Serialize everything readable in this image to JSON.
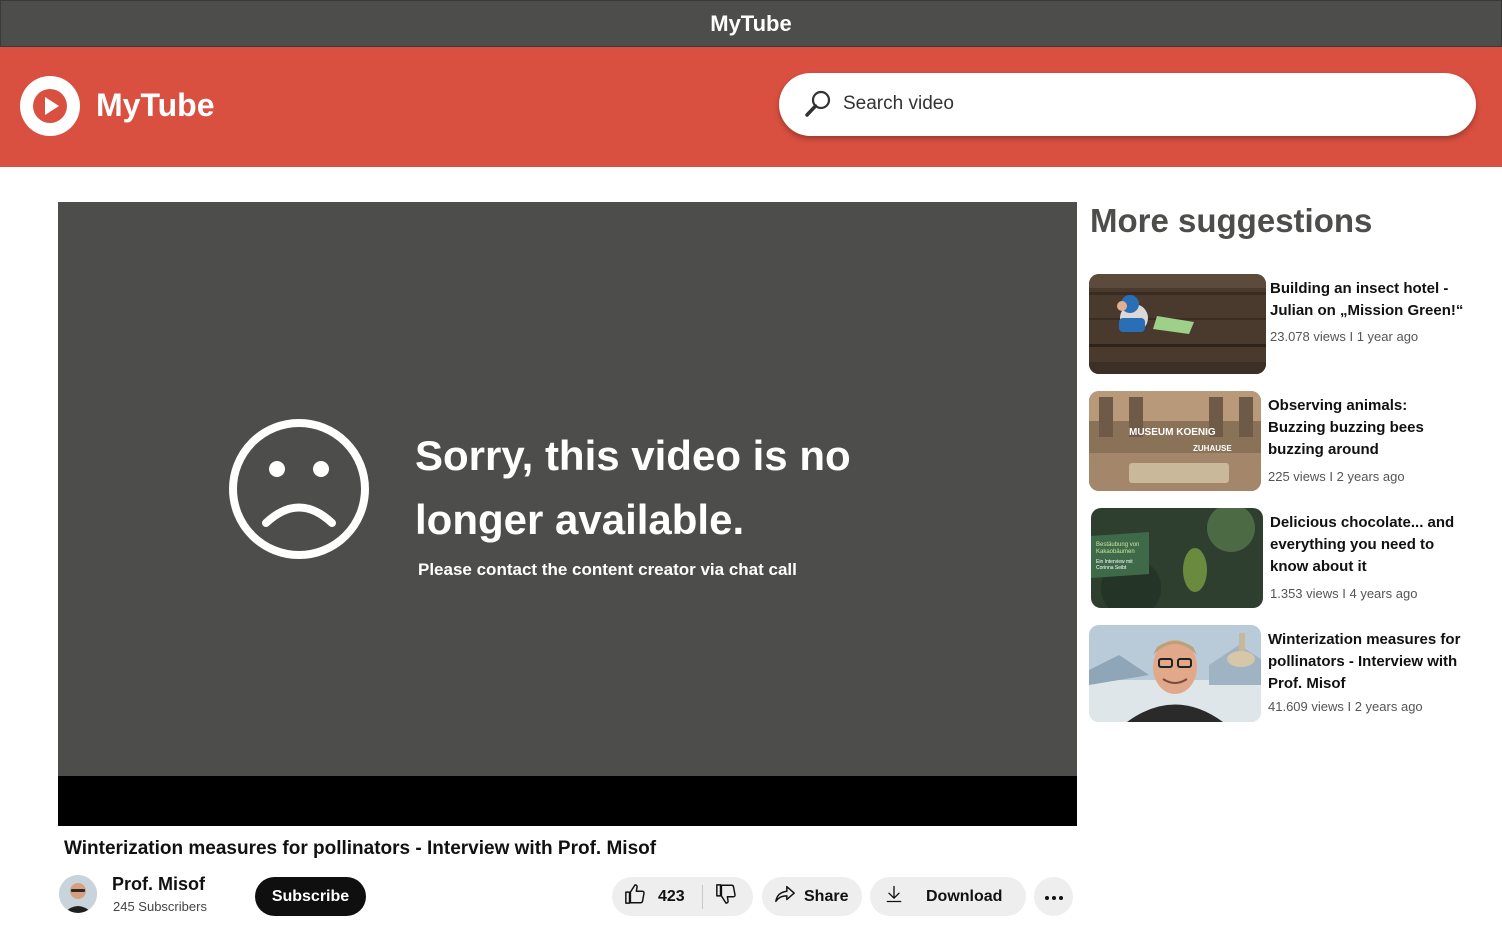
{
  "window": {
    "title": "MyTube"
  },
  "header": {
    "brand": "MyTube",
    "search_placeholder": "Search video",
    "logo_icon": "play-circle-icon",
    "search_icon": "magnifier-icon",
    "accent_color": "#d95040"
  },
  "player": {
    "error_title": "Sorry, this video is no longer available.",
    "error_subtitle": "Please contact the content creator via chat call",
    "icon": "sad-face-icon"
  },
  "video": {
    "title": "Winterization measures for pollinators - Interview with Prof. Misof",
    "channel_name": "Prof. Misof",
    "subscribers": "245 Subscribers",
    "subscribe_label": "Subscribe",
    "likes": "423",
    "share_label": "Share",
    "download_label": "Download"
  },
  "suggestions": {
    "heading": "More suggestions",
    "items": [
      {
        "title": "Building an insect hotel - Julian on „Mission Green!“",
        "meta": "23.078 views I 1 year ago"
      },
      {
        "title": "Observing animals: Buzzing buzzing bees buzzing around",
        "meta": "225 views I 2 years ago"
      },
      {
        "title": "Delicious chocolate... and everything you need to know about it",
        "meta": "1.353  views I 4 years ago"
      },
      {
        "title": "Winterization measures for pollinators - Interview with Prof. Misof",
        "meta": "41.609 views I 2 years ago"
      }
    ]
  }
}
